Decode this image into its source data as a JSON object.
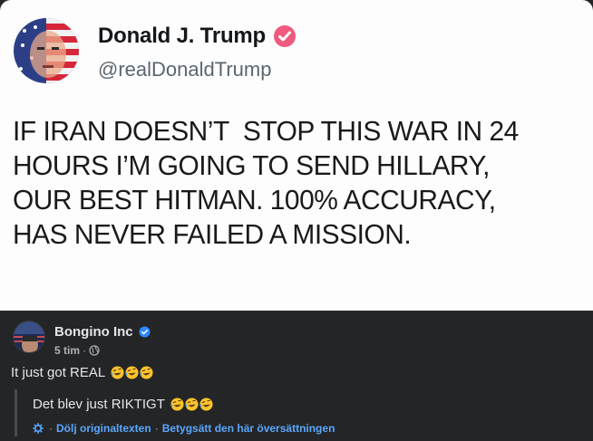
{
  "tweet": {
    "name": "Donald J. Trump",
    "handle": "@realDonaldTrump",
    "lines": [
      "IF IRAN DOESN’T  STOP THIS WAR IN 24",
      "HOURS I’M GOING TO SEND HILLARY,",
      "OUR BEST HITMAN. 100% ACCURACY,",
      "HAS NEVER FAILED A MISSION."
    ],
    "verified_color": "#f05a7e"
  },
  "post": {
    "page_name": "Bongino Inc",
    "time": "5 tim",
    "dot": "·",
    "text": "It just got REAL",
    "emoji": "rolling-on-floor-laughing-emoji",
    "verified_color": "#2d88ff"
  },
  "translation": {
    "text": "Det blev just RIKTIGT",
    "dot": "·",
    "hide_original": "Dölj originaltexten",
    "rate_translation": "Betygsätt den här översättningen",
    "link_color": "#5aa7ff"
  }
}
